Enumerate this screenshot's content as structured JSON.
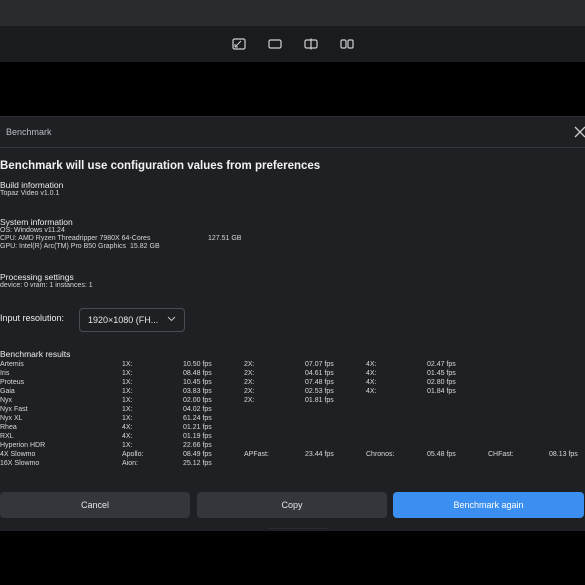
{
  "toolbar": {
    "icons": [
      "crop-icon",
      "single-view-icon",
      "split-view-icon",
      "side-by-side-icon"
    ]
  },
  "dialog": {
    "title": "Benchmark",
    "headline": "Benchmark will use configuration values from preferences",
    "build": {
      "heading": "Build information",
      "line": "Topaz Video v1.0.1"
    },
    "system": {
      "heading": "System information",
      "os": "OS: Windows v11.24",
      "cpu": "CPU: AMD Ryzen Threadripper 7980X 64-Cores",
      "cpu_mem": "127.51 GB",
      "gpu": "GPU: Intel(R) Arc(TM) Pro B50 Graphics",
      "gpu_mem": "15.82 GB"
    },
    "processing": {
      "heading": "Processing settings",
      "line": "device: 0 vram: 1 instances: 1"
    },
    "input": {
      "label": "Input resolution:",
      "value": "1920×1080 (FH..."
    },
    "results": {
      "heading": "Benchmark results",
      "rows": [
        [
          "Artemis",
          "1X:",
          "10.50 fps",
          "2X:",
          "07.07 fps",
          "4X:",
          "02.47 fps",
          "",
          ""
        ],
        [
          "Iris",
          "1X:",
          "08.48 fps",
          "2X:",
          "04.61 fps",
          "4X:",
          "01.45 fps",
          "",
          ""
        ],
        [
          "Proteus",
          "1X:",
          "10.45 fps",
          "2X:",
          "07.48 fps",
          "4X:",
          "02.80 fps",
          "",
          ""
        ],
        [
          "Gaia",
          "1X:",
          "03.83 fps",
          "2X:",
          "02.53 fps",
          "4X:",
          "01.84 fps",
          "",
          ""
        ],
        [
          "Nyx",
          "1X:",
          "02.00 fps",
          "2X:",
          "01.81 fps",
          "",
          "",
          "",
          ""
        ],
        [
          "Nyx Fast",
          "1X:",
          "04.02 fps",
          "",
          "",
          "",
          "",
          "",
          ""
        ],
        [
          "Nyx XL",
          "1X:",
          "61.24 fps",
          "",
          "",
          "",
          "",
          "",
          ""
        ],
        [
          "Rhea",
          "4X:",
          "01.21 fps",
          "",
          "",
          "",
          "",
          "",
          ""
        ],
        [
          "RXL",
          "4X:",
          "01.19 fps",
          "",
          "",
          "",
          "",
          "",
          ""
        ],
        [
          "Hyperion HDR",
          "1X:",
          "22.66 fps",
          "",
          "",
          "",
          "",
          "",
          ""
        ],
        [
          "4X Slowmo",
          "Apollo:",
          "08.49 fps",
          "APFast:",
          "23.44 fps",
          "Chronos:",
          "05.48 fps",
          "CHFast:",
          "08.13 fps"
        ],
        [
          "16X Slowmo",
          "Aion:",
          "25.12 fps",
          "",
          "",
          "",
          "",
          "",
          ""
        ]
      ]
    },
    "buttons": {
      "cancel": "Cancel",
      "copy": "Copy",
      "again": "Benchmark again"
    }
  },
  "colors": {
    "accent": "#3b8ff0",
    "dialog_bg": "#1f2023",
    "button_bg": "#35363b"
  }
}
